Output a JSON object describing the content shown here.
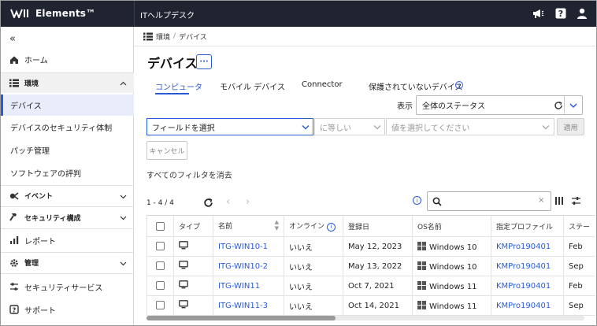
{
  "topbar": {
    "logo_text": "Elements™",
    "app_name": "ITヘルプデスク",
    "icons": [
      "megaphone-icon",
      "help-icon",
      "user-icon"
    ]
  },
  "sidebar": {
    "collapse_icon": "«",
    "items": [
      {
        "label": "ホーム",
        "icon": "home-icon"
      },
      {
        "label": "環境",
        "icon": "list-icon",
        "section": true
      },
      {
        "label": "デバイス",
        "active": true
      },
      {
        "label": "デバイスのセキュリティ体制"
      },
      {
        "label": "パッチ管理"
      },
      {
        "label": "ソフトウェアの評判"
      },
      {
        "label": "イベント",
        "icon": "event-icon"
      },
      {
        "label": "セキュリティ構成",
        "icon": "hammer-icon"
      },
      {
        "label": "レポート",
        "icon": "chart-icon"
      },
      {
        "label": "管理",
        "icon": "gear-icon"
      },
      {
        "label": "セキュリティサービス",
        "icon": "sliders-icon"
      },
      {
        "label": "サポート",
        "icon": "support-icon"
      }
    ]
  },
  "breadcrumb": {
    "part1": "環境",
    "separator": "/",
    "part2": "デバイス"
  },
  "page": {
    "title": "デバイス",
    "more_button": "···"
  },
  "tabs": [
    {
      "label": "コンピュータ",
      "active": true
    },
    {
      "label": "モバイル デバイス"
    },
    {
      "label": "Connector"
    },
    {
      "label": "保護されていないデバイス",
      "info": "i"
    }
  ],
  "view": {
    "label": "表示",
    "value": "全体のステータス"
  },
  "filter": {
    "field_placeholder": "フィールドを選択",
    "operator": "に等しい",
    "value_placeholder": "値を選択してください",
    "apply": "適用",
    "cancel": "キャンセル",
    "clear_all": "すべてのフィルタを消去"
  },
  "pager": {
    "range": "1 - 4 / 4",
    "prev": "‹",
    "next": "›"
  },
  "search": {
    "placeholder": "",
    "clear": "×",
    "info": "i"
  },
  "table": {
    "columns": [
      "タイプ",
      "名前",
      "オンライン",
      "登録日",
      "OS名前",
      "指定プロファイル",
      "ステー"
    ],
    "online_info": "i",
    "rows": [
      {
        "name": "ITG-WIN10-1",
        "online": "いいえ",
        "date": "May 12, 2023",
        "os": "Windows 10",
        "profile": "KMPro190401",
        "status": "Feb"
      },
      {
        "name": "ITG-WIN10-2",
        "online": "いいえ",
        "date": "May 13, 2022",
        "os": "Windows 10",
        "profile": "KMPro190401",
        "status": "Sep"
      },
      {
        "name": "ITG-WIN11",
        "online": "いいえ",
        "date": "Oct 7, 2021",
        "os": "Windows 11",
        "profile": "KMPro190401",
        "status": "Feb"
      },
      {
        "name": "ITG-WIN11-3",
        "online": "いいえ",
        "date": "Oct 14, 2021",
        "os": "Windows 11",
        "profile": "KMPro190401",
        "status": "Sep"
      }
    ]
  },
  "colors": {
    "accent": "#2a5bd7",
    "topbar": "#1f2430",
    "active_bg": "#e9edfb"
  }
}
